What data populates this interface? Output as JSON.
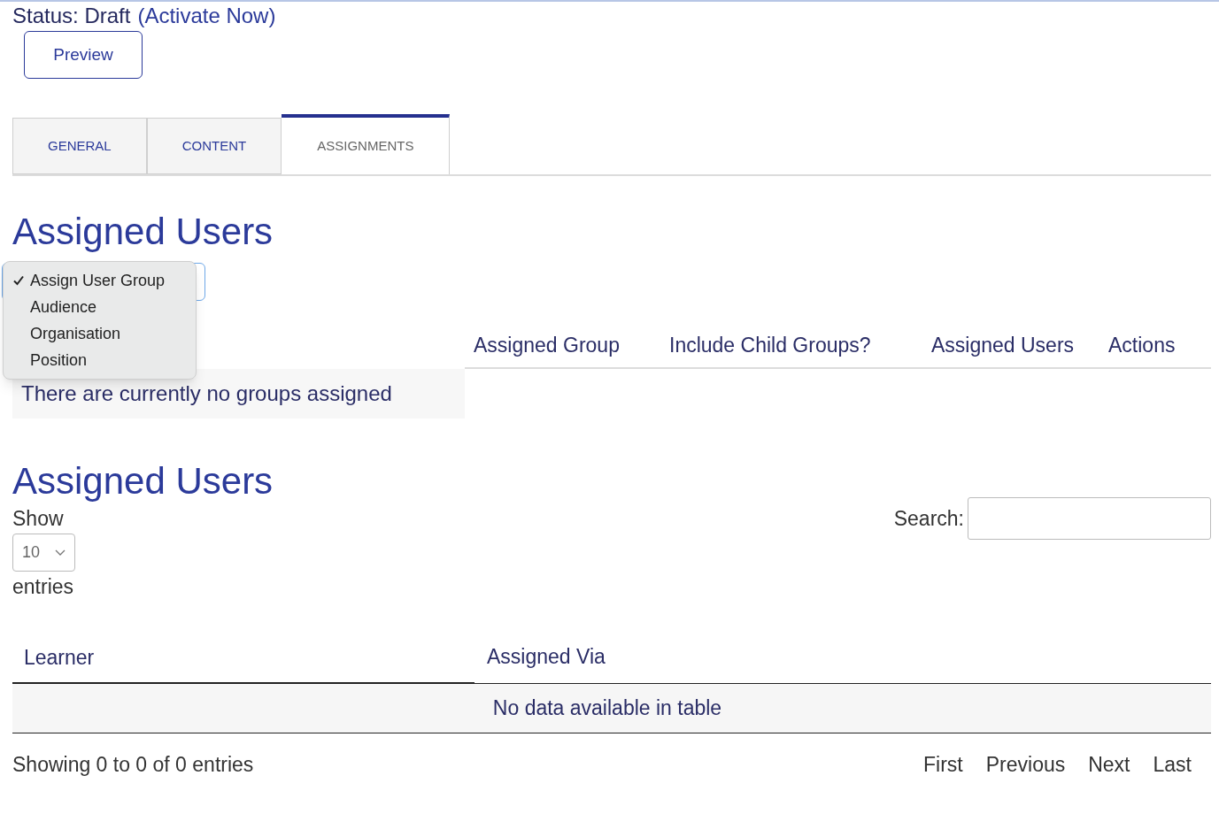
{
  "status": {
    "label": "Status: Draft",
    "link": "(Activate Now)"
  },
  "preview_button": "Preview",
  "tabs": [
    {
      "label": "GENERAL",
      "selected": false
    },
    {
      "label": "CONTENT",
      "selected": false
    },
    {
      "label": "ASSIGNMENTS",
      "selected": true
    }
  ],
  "groups_section": {
    "heading": "Assigned Users",
    "dropdown": {
      "options": [
        {
          "label": "Assign User Group",
          "selected": true
        },
        {
          "label": "Audience",
          "selected": false
        },
        {
          "label": "Organisation",
          "selected": false
        },
        {
          "label": "Position",
          "selected": false
        }
      ]
    },
    "columns": [
      "Assigned Group",
      "Include Child Groups?",
      "Assigned Users",
      "Actions"
    ],
    "empty_message": "There are currently no groups assigned"
  },
  "users_section": {
    "heading": "Assigned Users",
    "show_label": "Show",
    "page_size": "10",
    "entries_label": "entries",
    "search_label": "Search:",
    "columns": [
      "Learner",
      "Assigned Via"
    ],
    "empty_message": "No data available in table",
    "info": "Showing 0 to 0 of 0 entries",
    "pagination": [
      "First",
      "Previous",
      "Next",
      "Last"
    ]
  }
}
